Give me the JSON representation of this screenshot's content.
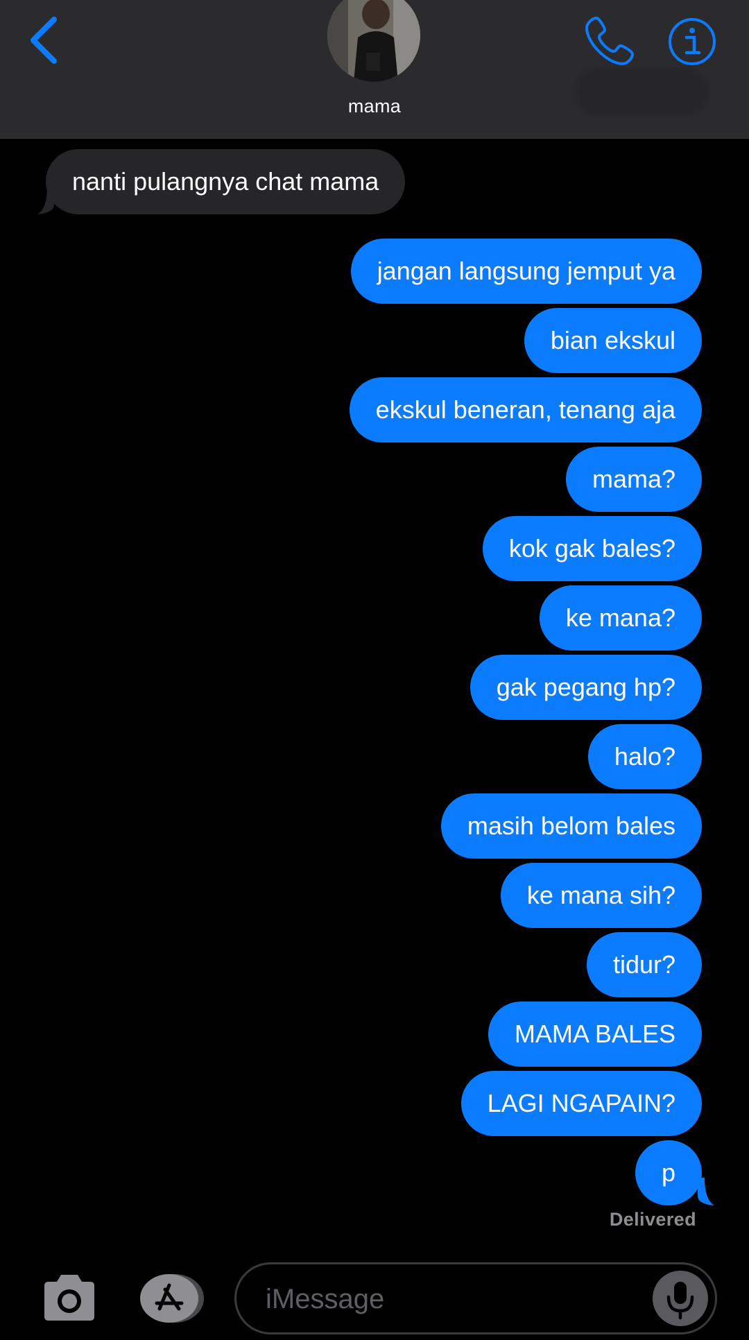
{
  "header": {
    "contact_name": "mama",
    "back_icon": "chevron-left-icon",
    "call_icon": "phone-icon",
    "info_icon": "info-icon",
    "accent": "#0b7cff"
  },
  "messages": [
    {
      "from": "received",
      "text": "nanti pulangnya chat mama"
    },
    {
      "from": "sent",
      "text": "jangan langsung jemput ya"
    },
    {
      "from": "sent",
      "text": "bian ekskul"
    },
    {
      "from": "sent",
      "text": "ekskul beneran, tenang aja"
    },
    {
      "from": "sent",
      "text": "mama?"
    },
    {
      "from": "sent",
      "text": "kok gak bales?"
    },
    {
      "from": "sent",
      "text": "ke mana?"
    },
    {
      "from": "sent",
      "text": "gak pegang hp?"
    },
    {
      "from": "sent",
      "text": "halo?"
    },
    {
      "from": "sent",
      "text": "masih belom bales"
    },
    {
      "from": "sent",
      "text": "ke mana sih?"
    },
    {
      "from": "sent",
      "text": "tidur?"
    },
    {
      "from": "sent",
      "text": "MAMA BALES"
    },
    {
      "from": "sent",
      "text": "LAGI NGAPAIN?"
    },
    {
      "from": "sent",
      "text": "p"
    }
  ],
  "status": {
    "delivered": "Delivered"
  },
  "composer": {
    "placeholder": "iMessage",
    "camera_icon": "camera-icon",
    "appstore_icon": "app-store-icon",
    "mic_icon": "microphone-icon"
  },
  "colors": {
    "sent_bubble": "#0b7cff",
    "received_bubble": "#262628",
    "header_bg": "#2b2b2d"
  }
}
